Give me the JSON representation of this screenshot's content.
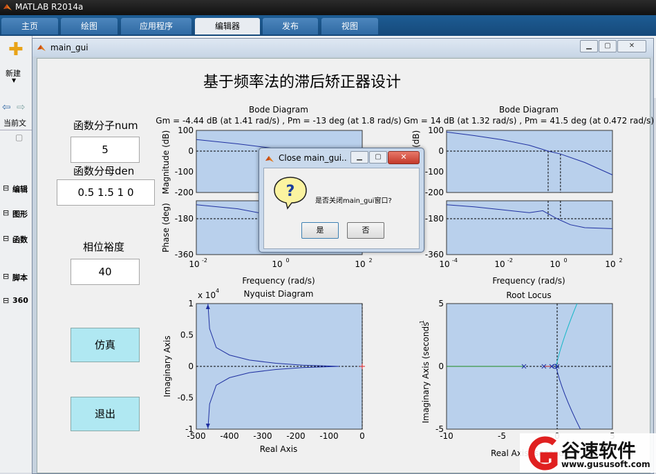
{
  "app": {
    "title": "MATLAB R2014a"
  },
  "tabs": [
    "主页",
    "绘图",
    "应用程序",
    "编辑器",
    "发布",
    "视图"
  ],
  "active_tab": "编辑器",
  "ribbon": {
    "new_label": "新建"
  },
  "left_panel": {
    "current_folder": "当前文",
    "sections": [
      "编辑",
      "图形",
      "函数",
      "脚本",
      "360"
    ]
  },
  "gui": {
    "window_title": "main_gui",
    "heading": "基于频率法的滞后矫正器设计",
    "num_label": "函数分子num",
    "num_value": "5",
    "den_label": "函数分母den",
    "den_value": "0.5 1.5 1 0",
    "pm_label": "相位裕度",
    "pm_value": "40",
    "simulate_label": "仿真",
    "exit_label": "退出"
  },
  "dialog": {
    "title": "Close main_gui...",
    "message": "是否关闭main_gui窗口?",
    "yes_label": "是",
    "no_label": "否",
    "icon": "question-icon"
  },
  "chart_data": [
    {
      "type": "line",
      "title": "Bode Diagram",
      "subtitle": "Gm = -4.44 dB (at 1.41 rad/s) ,  Pm = -13 deg (at 1.8 rad/s)",
      "xlabel": "Frequency  (rad/s)",
      "ylabel_mag": "Magnitude (dB)",
      "ylabel_phase": "Phase (deg)",
      "xscale": "log",
      "xlim": [
        0.01,
        100
      ],
      "x_ticks": [
        "10",
        "10",
        "10"
      ],
      "x_tick_exp": [
        "-2",
        "0",
        "2"
      ],
      "mag_ylim": [
        -200,
        100
      ],
      "mag_ticks": [
        "100",
        "0",
        "-100",
        "-200"
      ],
      "phase_ylim": [
        -360,
        -90
      ],
      "phase_ticks": [
        "-180",
        "-360"
      ],
      "magnitude": {
        "x": [
          0.01,
          0.1,
          1
        ],
        "y": [
          56,
          35,
          10
        ]
      },
      "phase": {
        "x": [
          0.01,
          0.1,
          1
        ],
        "y": [
          -110,
          -130,
          -170
        ]
      }
    },
    {
      "type": "line",
      "title": "Bode Diagram",
      "subtitle": "Gm = 14 dB (at 1.32 rad/s) ,  Pm = 41.5 deg (at 0.472 rad/s)",
      "xlabel": "Frequency  (rad/s)",
      "ylabel_mag": "Magnitude (dB)",
      "ylabel_phase": "Phase (deg)",
      "xscale": "log",
      "xlim": [
        0.0001,
        100
      ],
      "x_ticks": [
        "10",
        "10",
        "10",
        "10"
      ],
      "x_tick_exp": [
        "-4",
        "-2",
        "0",
        "2"
      ],
      "mag_ylim": [
        -200,
        100
      ],
      "mag_ticks": [
        "100",
        "0",
        "-100",
        "-200"
      ],
      "phase_ylim": [
        -360,
        -90
      ],
      "phase_ticks": [
        "-180",
        "-360"
      ],
      "magnitude": {
        "x": [
          0.0001,
          0.001,
          0.01,
          0.1,
          0.472,
          1.32,
          10,
          100
        ],
        "y": [
          92,
          75,
          55,
          28,
          0,
          -14,
          -55,
          -115
        ]
      },
      "phase": {
        "x": [
          0.0001,
          0.001,
          0.01,
          0.1,
          0.3,
          1,
          3,
          10,
          100
        ],
        "y": [
          -110,
          -120,
          -135,
          -150,
          -140,
          -180,
          -210,
          -225,
          -230
        ]
      }
    },
    {
      "type": "line",
      "title": "Nyquist Diagram",
      "xlabel": "Real Axis",
      "ylabel": "Imaginary Axis",
      "y_multiplier": "x 10",
      "y_multiplier_exp": "4",
      "xlim": [
        -500,
        0
      ],
      "ylim": [
        -1,
        1
      ],
      "x_ticks": [
        "-500",
        "-400",
        "-300",
        "-200",
        "-100",
        "0"
      ],
      "y_ticks": [
        "1",
        "0.5",
        "0",
        "-0.5",
        "-1"
      ]
    },
    {
      "type": "scatter",
      "title": "Root Locus",
      "xlabel": "Real Axis (seconds",
      "ylabel": "Imaginary Axis (seconds",
      "unit_exp": "-1",
      "xlim": [
        -10,
        5
      ],
      "ylim": [
        -5,
        5
      ],
      "x_ticks": [
        "-10",
        "-5",
        "0",
        "5"
      ],
      "y_ticks": [
        "5",
        "0",
        "-5"
      ],
      "poles": [
        -3,
        -1.2,
        -0.5,
        0
      ],
      "zeros": [
        -0.2
      ]
    }
  ],
  "watermark": {
    "brand": "谷速软件",
    "url": "www.gususoft.com"
  }
}
